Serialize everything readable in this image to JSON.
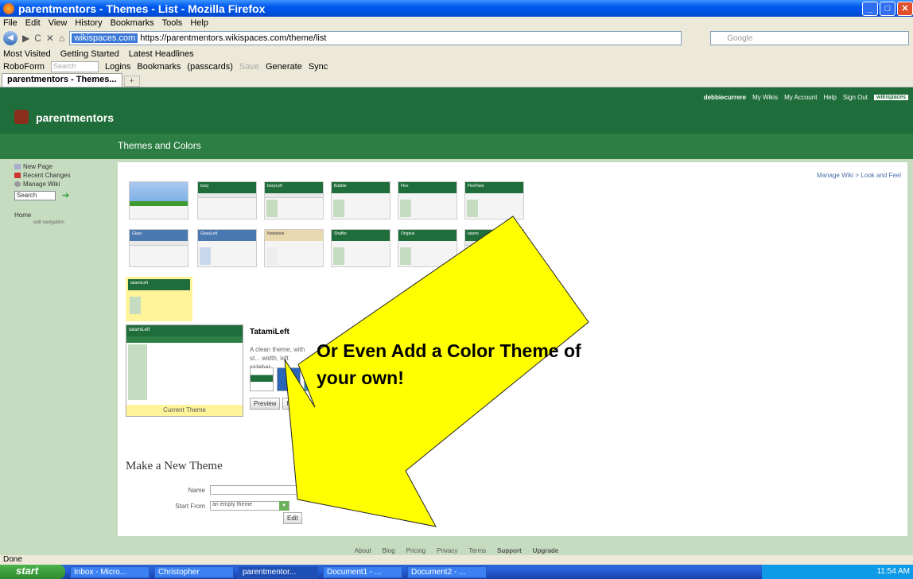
{
  "window": {
    "title": "parentmentors - Themes - List - Mozilla Firefox"
  },
  "menu": [
    "File",
    "Edit",
    "View",
    "History",
    "Bookmarks",
    "Tools",
    "Help"
  ],
  "address": {
    "domain": "wikispaces.com",
    "url": "https://parentmentors.wikispaces.com/theme/list",
    "search_placeholder": "Google"
  },
  "bookmarks": [
    "Most Visited",
    "Getting Started",
    "Latest Headlines"
  ],
  "roboform": {
    "label": "RoboForm",
    "search": "Search",
    "logins": "Logins",
    "bookmarks": "Bookmarks",
    "passcards": "(passcards)",
    "save": "Save",
    "generate": "Generate",
    "sync": "Sync"
  },
  "tab": {
    "label": "parentmentors - Themes...",
    "new": "+"
  },
  "wiki": {
    "name": "parentmentors",
    "page_title": "Themes and Colors",
    "user": "debbiecurrere",
    "user_links": [
      "My Wikis",
      "My Account",
      "Help",
      "Sign Out"
    ],
    "badge": "wikispaces"
  },
  "sidebar": {
    "new_page": "New Page",
    "recent": "Recent Changes",
    "manage": "Manage Wiki",
    "search": "Search",
    "home": "Home",
    "edit_nav": "edit navigation"
  },
  "breadcrumb": "Manage Wiki > Look and Feel",
  "themes": [
    {
      "label": ""
    },
    {
      "label": "bosy"
    },
    {
      "label": "bosyLeft"
    },
    {
      "label": "Bubble"
    },
    {
      "label": "Flex"
    },
    {
      "label": "FlexFluid"
    },
    {
      "label": "Glass"
    },
    {
      "label": "GlassLeft"
    },
    {
      "label": "Notebook"
    },
    {
      "label": "Shaffer"
    },
    {
      "label": "Original"
    },
    {
      "label": "tatami"
    },
    {
      "label": "tatamiLeft"
    }
  ],
  "detail": {
    "thumb_label": "tatamiLeft",
    "title": "TatamiLeft",
    "desc": "A clean theme, with st... width, left sidebar",
    "current": "Current Theme",
    "preview": "Preview",
    "use": "Pr..."
  },
  "new_theme": {
    "title": "Make a New Theme",
    "name_label": "Name",
    "start_label": "Start From",
    "start_value": "an empty theme",
    "edit": "Edit"
  },
  "footer": [
    "About",
    "Blog",
    "Pricing",
    "Privacy",
    "Terms",
    "Support",
    "Upgrade"
  ],
  "annotation": {
    "text": "Or Even Add a Color Theme of your own!",
    "arrow_color": "#FFFF00"
  },
  "status": "Done",
  "taskbar": {
    "start": "start",
    "items": [
      "Inbox - Micro...",
      "Christopher",
      "parentmentor...",
      "Document1 - ...",
      "Document2 - ..."
    ],
    "clock": "11:54 AM"
  }
}
